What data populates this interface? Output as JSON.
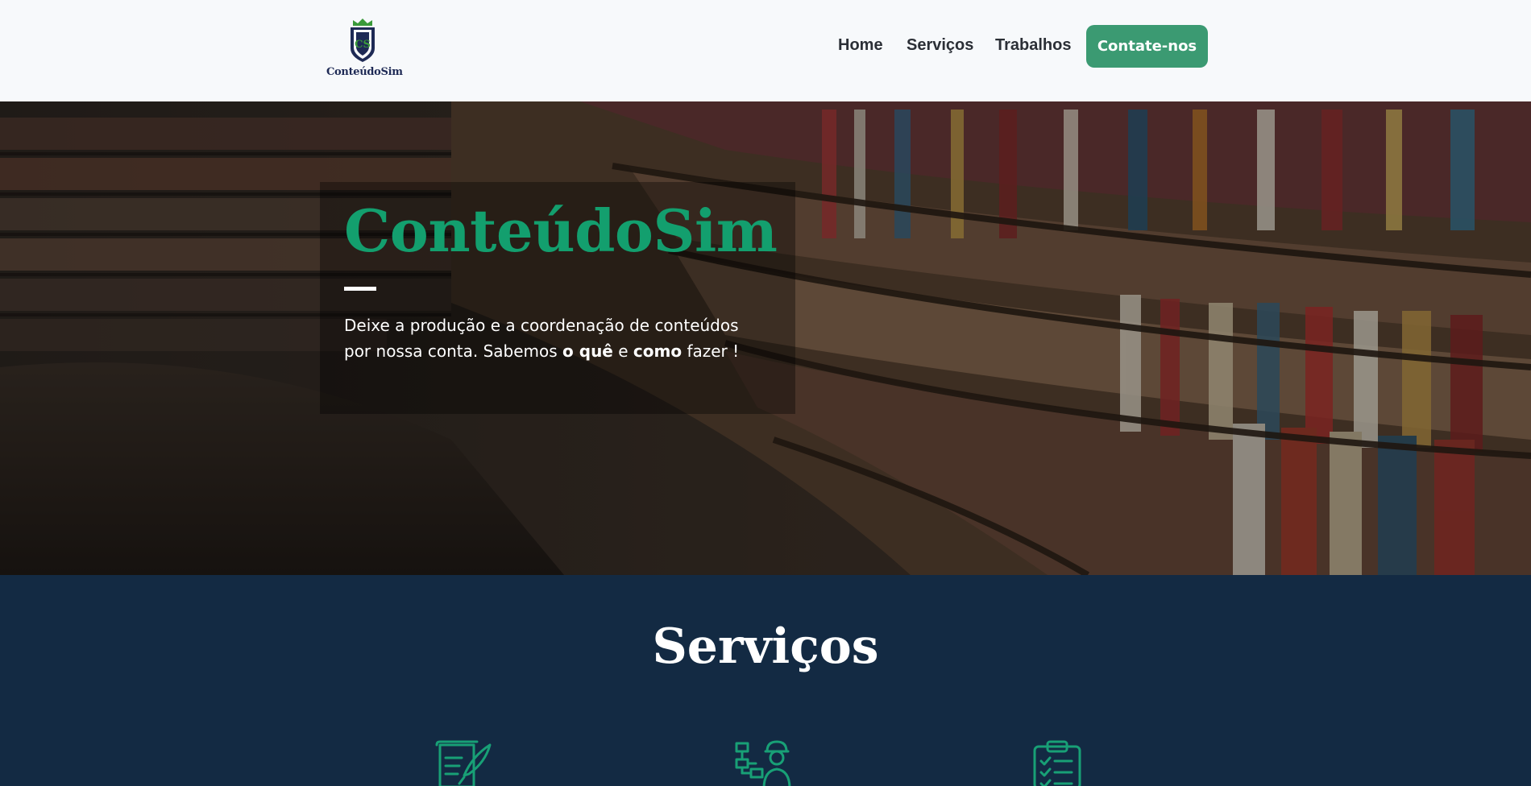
{
  "header": {
    "logo_text": "ConteúdoSim",
    "nav": {
      "home": "Home",
      "servicos": "Serviços",
      "trabalhos": "Trabalhos",
      "cta": "Contate-nos"
    }
  },
  "hero": {
    "title": "ConteúdoSim",
    "text_part1": "Deixe a produção e a coordenação de conteúdos por nossa conta. Sabemos ",
    "text_bold1": "o quê",
    "text_part2": " e ",
    "text_bold2": "como",
    "text_part3": " fazer !"
  },
  "services": {
    "title": "Serviços",
    "icons": [
      "document-quill-icon",
      "worker-flowchart-icon",
      "clipboard-checklist-icon"
    ]
  },
  "colors": {
    "accent_green": "#139f6e",
    "button_green": "#3b9a72",
    "navy": "#132a43",
    "header_bg": "#f7f9fb"
  }
}
